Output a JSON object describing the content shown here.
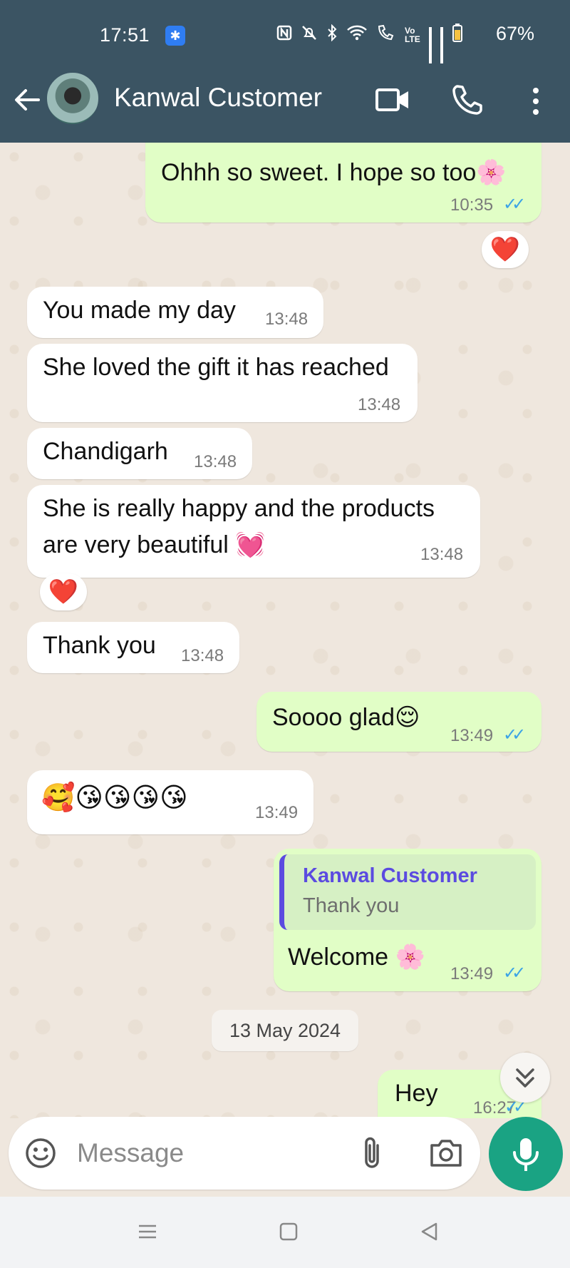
{
  "status_bar": {
    "time": "17:51",
    "bluetooth_badge": "✱",
    "network_label": "Vo LTE",
    "battery": "67%"
  },
  "header": {
    "contact_name": "Kanwal Customer",
    "icons": [
      "back-arrow-icon",
      "video-call-icon",
      "voice-call-icon",
      "more-options-icon"
    ]
  },
  "messages": [
    {
      "dir": "out",
      "text": "Ohhh so sweet. I hope so too🌸",
      "time": "10:35",
      "status": "read",
      "reaction": "❤️"
    },
    {
      "dir": "in",
      "text": "You made my day",
      "time": "13:48"
    },
    {
      "dir": "in",
      "text": "She loved the gift it has reached",
      "time": "13:48"
    },
    {
      "dir": "in",
      "text": "Chandigarh",
      "time": "13:48"
    },
    {
      "dir": "in",
      "text_line1": "She is really happy and the products",
      "text_line2": "are very beautiful 💓",
      "time": "13:48",
      "reaction": "❤️"
    },
    {
      "dir": "in",
      "text": "Thank you",
      "time": "13:48"
    },
    {
      "dir": "out",
      "text": "Soooo glad😌",
      "time": "13:49",
      "status": "read"
    },
    {
      "dir": "in",
      "text": "🥰😘😘😘😘",
      "time": "13:49"
    },
    {
      "dir": "out",
      "quote_name": "Kanwal Customer",
      "quote_text": "Thank you",
      "text": "Welcome 🌸",
      "time": "13:49",
      "status": "read"
    },
    {
      "dir": "out",
      "text": "Hey",
      "time": "16:27",
      "status": "read"
    }
  ],
  "date_separator": "13 May 2024",
  "composer": {
    "placeholder": "Message",
    "icons": [
      "emoji-icon",
      "attach-icon",
      "camera-icon",
      "mic-icon"
    ]
  },
  "colors": {
    "header": "#3b5463",
    "outgoing_bubble": "#e1fec6",
    "incoming_bubble": "#ffffff",
    "chat_background": "#efe7de",
    "read_ticks": "#3ba3e6",
    "mic_button": "#1aa383",
    "quote_accent": "#5b4be0"
  }
}
